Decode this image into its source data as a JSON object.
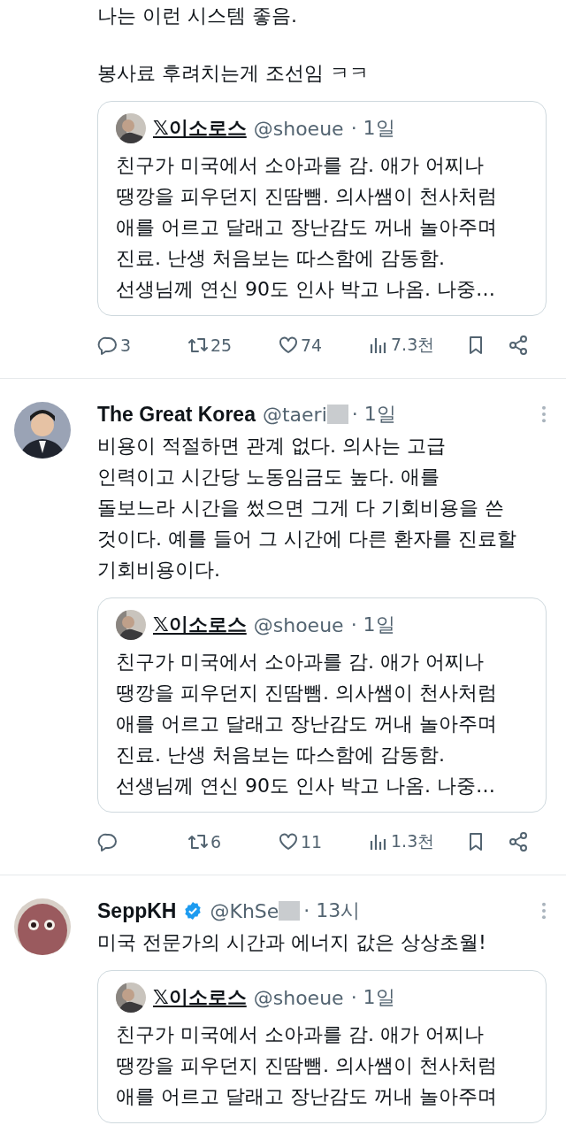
{
  "tweets": [
    {
      "paragraphs": [
        [
          "나는 이런 시스템 좋음."
        ],
        [
          "봉사료 후려치는게 조선임 ㅋㅋ"
        ]
      ],
      "quote": {
        "name": "𝕏이소로스",
        "handle": "@shoeue",
        "time": "· 1일",
        "lines": [
          "친구가 미국에서 소아과를 감. 애가 어찌나",
          "땡깡을 피우던지 진땀뺌. 의사쌤이 천사처럼",
          "애를 어르고 달래고 장난감도 꺼내 놀아주며",
          "진료. 난생 처음보는 따스함에 감동함.",
          "선생님께 연신 90도 인사 박고 나옴. 나중…"
        ]
      },
      "actions": {
        "replies": "3",
        "reposts": "25",
        "likes": "74",
        "views": "7.3천"
      }
    },
    {
      "author": {
        "name": "The Great Korea",
        "handle": "@taeri",
        "redacted": true,
        "verified": false,
        "time": "· 1일"
      },
      "paragraphs": [
        [
          "비용이 적절하면 관계 없다. 의사는 고급",
          "인력이고 시간당 노동임금도 높다. 애를",
          "돌보느라 시간을 썼으면 그게 다 기회비용을 쓴",
          "것이다. 예를 들어 그 시간에 다른 환자를 진료할",
          "기회비용이다."
        ]
      ],
      "quote": {
        "name": "𝕏이소로스",
        "handle": "@shoeue",
        "time": "· 1일",
        "lines": [
          "친구가 미국에서 소아과를 감. 애가 어찌나",
          "땡깡을 피우던지 진땀뺌. 의사쌤이 천사처럼",
          "애를 어르고 달래고 장난감도 꺼내 놀아주며",
          "진료. 난생 처음보는 따스함에 감동함.",
          "선생님께 연신 90도 인사 박고 나옴. 나중…"
        ]
      },
      "actions": {
        "reposts": "6",
        "likes": "11",
        "views": "1.3천"
      }
    },
    {
      "author": {
        "name": "SeppKH",
        "handle": "@KhSe",
        "redacted": true,
        "verified": true,
        "time": "· 13시"
      },
      "paragraphs": [
        [
          "미국 전문가의 시간과 에너지 값은 상상초월!"
        ]
      ],
      "quote": {
        "name": "𝕏이소로스",
        "handle": "@shoeue",
        "time": "· 1일",
        "lines": [
          "친구가 미국에서 소아과를 감. 애가 어찌나",
          "땡깡을 피우던지 진땀뺌. 의사쌤이 천사처럼",
          "애를 어르고 달래고 장난감도 꺼내 놀아주며"
        ]
      }
    }
  ]
}
